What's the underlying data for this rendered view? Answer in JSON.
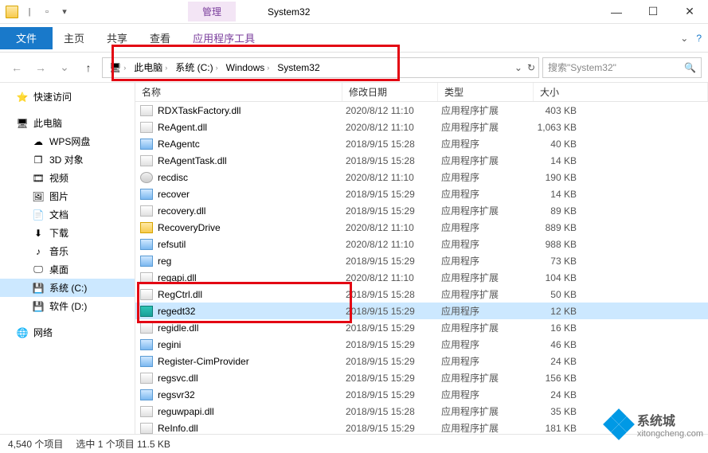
{
  "window": {
    "title": "System32",
    "ribbon_context": "管理",
    "ribbon_context_sub": "应用程序工具",
    "menu": {
      "file": "文件",
      "home": "主页",
      "share": "共享",
      "view": "查看"
    }
  },
  "address": {
    "crumbs": [
      "此电脑",
      "系统 (C:)",
      "Windows",
      "System32"
    ],
    "search_placeholder": "搜索\"System32\""
  },
  "nav": {
    "quick": "快速访问",
    "pc": "此电脑",
    "items": [
      "WPS网盘",
      "3D 对象",
      "视频",
      "图片",
      "文档",
      "下载",
      "音乐",
      "桌面",
      "系统 (C:)",
      "软件 (D:)"
    ],
    "network": "网络"
  },
  "columns": {
    "name": "名称",
    "date": "修改日期",
    "type": "类型",
    "size": "大小"
  },
  "type_labels": {
    "ext": "应用程序扩展",
    "app": "应用程序"
  },
  "files": [
    {
      "icon": "dll",
      "name": "RDXTaskFactory.dll",
      "date": "2020/8/12 11:10",
      "type": "ext",
      "size": "403 KB"
    },
    {
      "icon": "dll",
      "name": "ReAgent.dll",
      "date": "2020/8/12 11:10",
      "type": "ext",
      "size": "1,063 KB"
    },
    {
      "icon": "exe",
      "name": "ReAgentc",
      "date": "2018/9/15 15:28",
      "type": "app",
      "size": "40 KB"
    },
    {
      "icon": "dll",
      "name": "ReAgentTask.dll",
      "date": "2018/9/15 15:28",
      "type": "ext",
      "size": "14 KB"
    },
    {
      "icon": "disc",
      "name": "recdisc",
      "date": "2020/8/12 11:10",
      "type": "app",
      "size": "190 KB"
    },
    {
      "icon": "exe",
      "name": "recover",
      "date": "2018/9/15 15:29",
      "type": "app",
      "size": "14 KB"
    },
    {
      "icon": "dll",
      "name": "recovery.dll",
      "date": "2018/9/15 15:29",
      "type": "ext",
      "size": "89 KB"
    },
    {
      "icon": "folder",
      "name": "RecoveryDrive",
      "date": "2020/8/12 11:10",
      "type": "app",
      "size": "889 KB"
    },
    {
      "icon": "exe",
      "name": "refsutil",
      "date": "2020/8/12 11:10",
      "type": "app",
      "size": "988 KB"
    },
    {
      "icon": "exe",
      "name": "reg",
      "date": "2018/9/15 15:29",
      "type": "app",
      "size": "73 KB"
    },
    {
      "icon": "dll",
      "name": "regapi.dll",
      "date": "2020/8/12 11:10",
      "type": "ext",
      "size": "104 KB"
    },
    {
      "icon": "dll",
      "name": "RegCtrl.dll",
      "date": "2018/9/15 15:28",
      "type": "ext",
      "size": "50 KB"
    },
    {
      "icon": "sel",
      "name": "regedt32",
      "date": "2018/9/15 15:29",
      "type": "app",
      "size": "12 KB",
      "selected": true
    },
    {
      "icon": "dll",
      "name": "regidle.dll",
      "date": "2018/9/15 15:29",
      "type": "ext",
      "size": "16 KB"
    },
    {
      "icon": "exe",
      "name": "regini",
      "date": "2018/9/15 15:29",
      "type": "app",
      "size": "46 KB"
    },
    {
      "icon": "exe",
      "name": "Register-CimProvider",
      "date": "2018/9/15 15:29",
      "type": "app",
      "size": "24 KB"
    },
    {
      "icon": "dll",
      "name": "regsvc.dll",
      "date": "2018/9/15 15:29",
      "type": "ext",
      "size": "156 KB"
    },
    {
      "icon": "exe",
      "name": "regsvr32",
      "date": "2018/9/15 15:29",
      "type": "app",
      "size": "24 KB"
    },
    {
      "icon": "dll",
      "name": "reguwpapi.dll",
      "date": "2018/9/15 15:28",
      "type": "ext",
      "size": "35 KB"
    },
    {
      "icon": "dll",
      "name": "ReInfo.dll",
      "date": "2018/9/15 15:29",
      "type": "ext",
      "size": "181 KB"
    }
  ],
  "status": {
    "total": "4,540 个项目",
    "selected": "选中 1 个项目  11.5 KB"
  },
  "watermark": {
    "text": "系统城",
    "url": "xitongcheng.com"
  }
}
